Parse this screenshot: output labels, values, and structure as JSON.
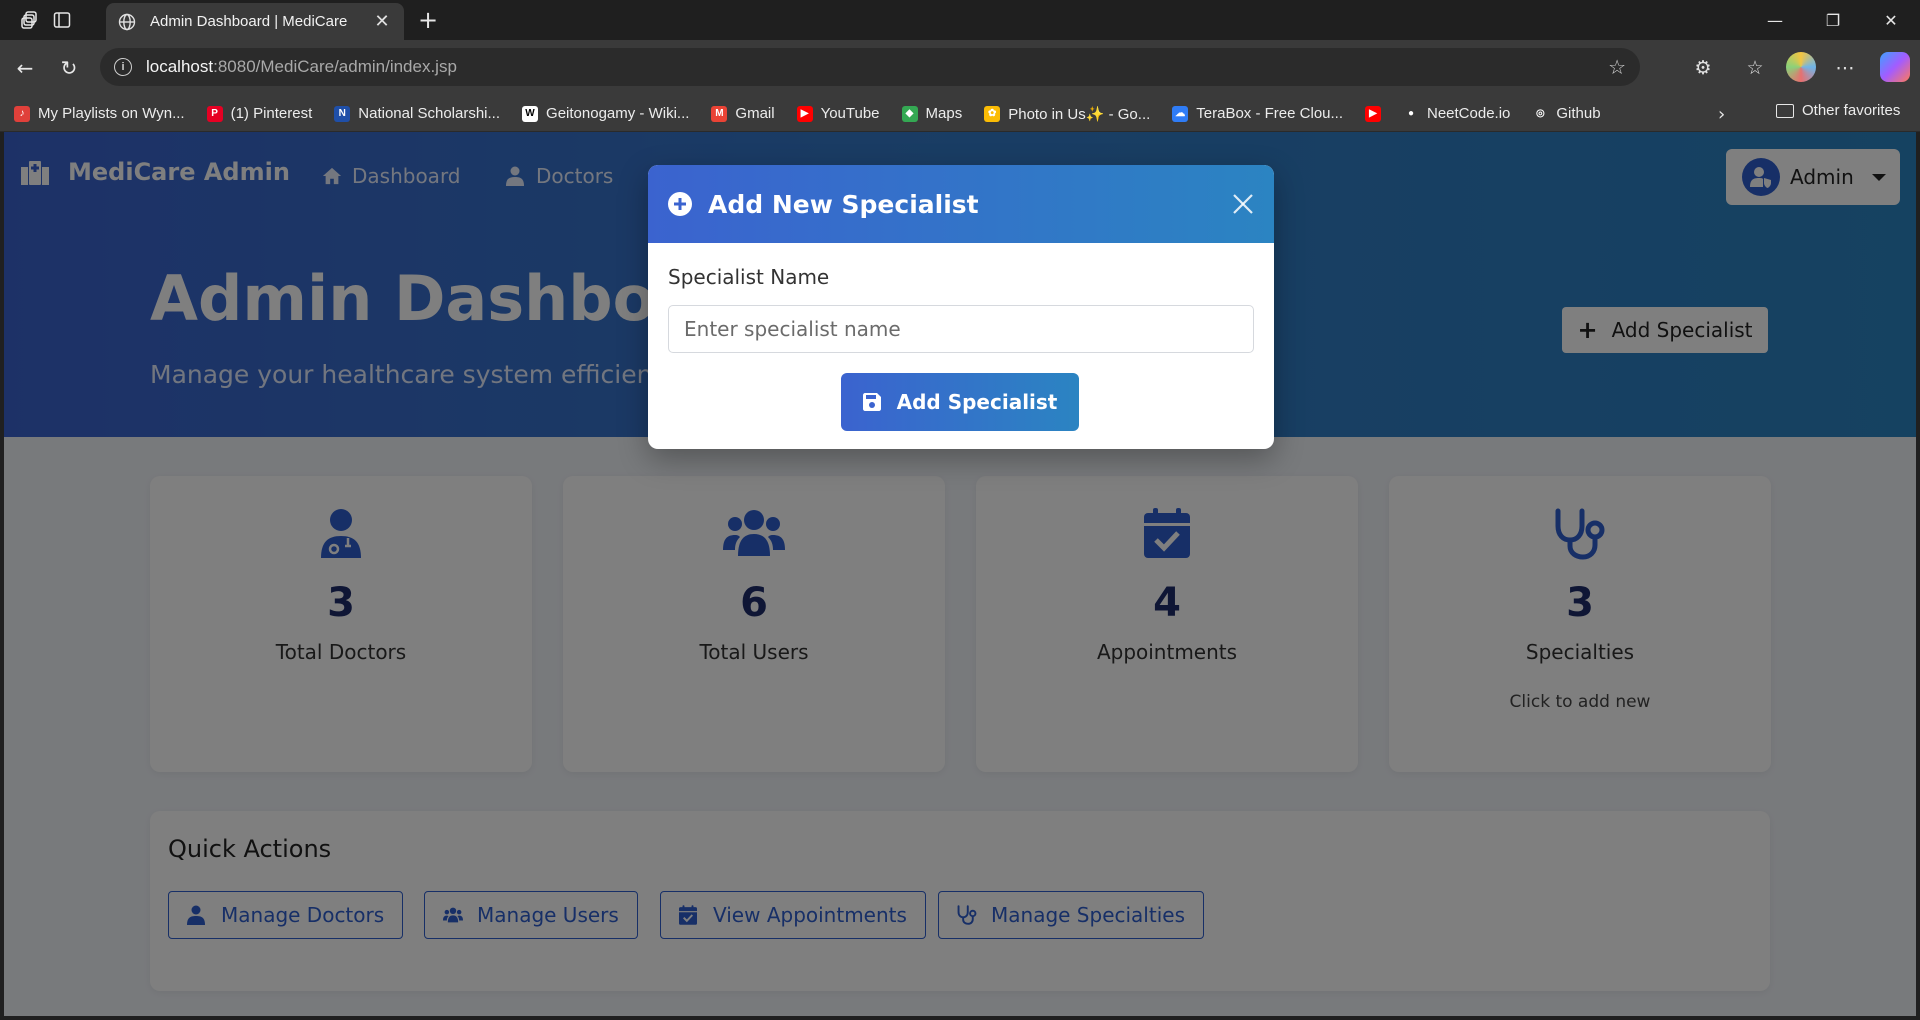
{
  "browser": {
    "tab_title": "Admin Dashboard | MediCare",
    "url_host": "localhost",
    "url_path": ":8080/MediCare/admin/index.jsp",
    "bookmarks": [
      {
        "label": "My Playlists on Wyn...",
        "color": "#e0403a",
        "glyph": "♪"
      },
      {
        "label": "(1) Pinterest",
        "color": "#e60023",
        "glyph": "P"
      },
      {
        "label": "National Scholarshi...",
        "color": "#1f4fa8",
        "glyph": "N"
      },
      {
        "label": "Geitonogamy - Wiki...",
        "color": "#ffffff",
        "glyph": "W"
      },
      {
        "label": "Gmail",
        "color": "#ea4335",
        "glyph": "M"
      },
      {
        "label": "YouTube",
        "color": "#ff0000",
        "glyph": "▶"
      },
      {
        "label": "Maps",
        "color": "#34a853",
        "glyph": "◆"
      },
      {
        "label": "Photo in Us✨ - Go...",
        "color": "#fbbc05",
        "glyph": "✿"
      },
      {
        "label": "TeraBox - Free Clou...",
        "color": "#2f7cf6",
        "glyph": "☁"
      },
      {
        "label": "",
        "color": "#ff0000",
        "glyph": "▶"
      },
      {
        "label": "NeetCode.io",
        "color": "#3a3a3a",
        "glyph": "●"
      },
      {
        "label": "Github",
        "color": "#3a3a3a",
        "glyph": "◎"
      }
    ],
    "other_favorites": "Other favorites"
  },
  "nav": {
    "brand": "MediCare Admin",
    "links": [
      "Dashboard",
      "Doctors"
    ],
    "admin_label": "Admin"
  },
  "hero": {
    "title": "Admin Dashboard",
    "subtitle": "Manage your healthcare system efficiently",
    "add_button": "Add Specialist"
  },
  "stats": [
    {
      "value": "3",
      "label": "Total Doctors",
      "icon": "doctor-icon"
    },
    {
      "value": "6",
      "label": "Total Users",
      "icon": "users-icon"
    },
    {
      "value": "4",
      "label": "Appointments",
      "icon": "calendar-check-icon"
    },
    {
      "value": "3",
      "label": "Specialties",
      "icon": "stethoscope-icon",
      "hint": "Click to add new"
    }
  ],
  "quick_actions": {
    "title": "Quick Actions",
    "buttons": [
      "Manage Doctors",
      "Manage Users",
      "View Appointments",
      "Manage Specialties"
    ]
  },
  "modal": {
    "title": "Add New Specialist",
    "field_label": "Specialist Name",
    "field_placeholder": "Enter specialist name",
    "field_value": "",
    "submit_label": "Add Specialist"
  },
  "colors": {
    "primary": "#2f5fcf",
    "gradient_start": "#3b63cf",
    "gradient_end": "#2b84c2",
    "stat_number": "#1e2d6b"
  }
}
